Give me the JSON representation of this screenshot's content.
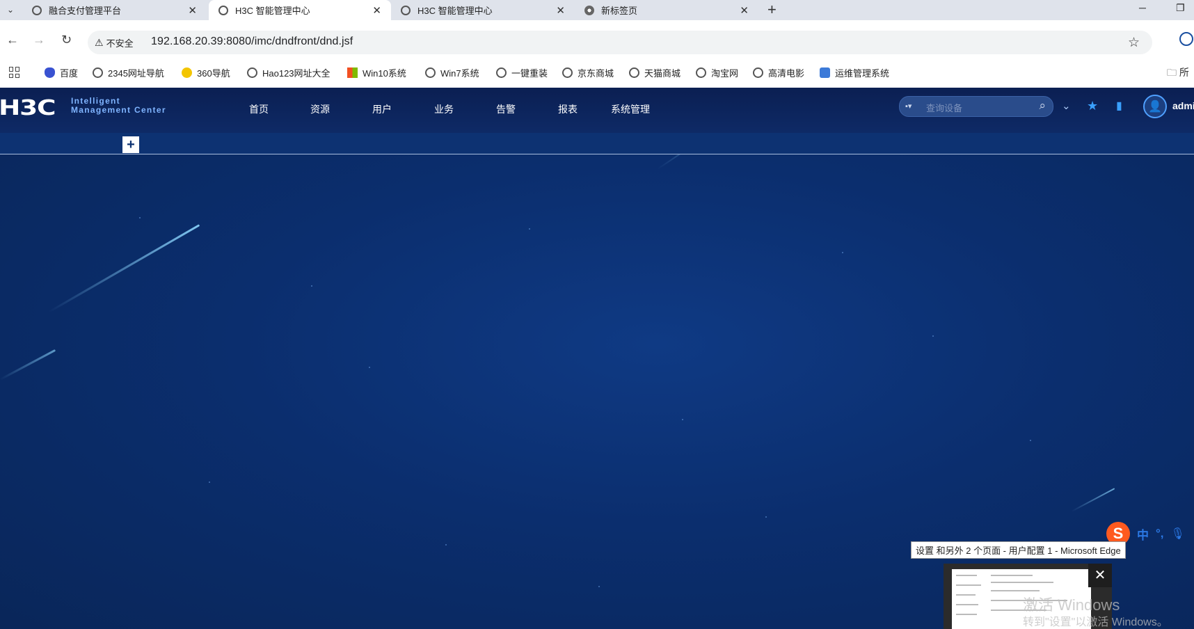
{
  "browser": {
    "tabs": [
      {
        "title": "融合支付管理平台",
        "active": false
      },
      {
        "title": "H3C 智能管理中心",
        "active": true
      },
      {
        "title": "H3C 智能管理中心",
        "active": false
      },
      {
        "title": "新标签页",
        "active": false
      }
    ],
    "security_label": "不安全",
    "url": "192.168.20.39:8080/imc/dndfront/dnd.jsf",
    "bookmarks": [
      "百度",
      "2345网址导航",
      "360导航",
      "Hao123网址大全",
      "Win10系统",
      "Win7系统",
      "一键重装",
      "京东商城",
      "天猫商城",
      "淘宝网",
      "高清电影",
      "运维管理系统"
    ],
    "bookmarks_overflow": "所"
  },
  "app": {
    "logo": "H3C",
    "logo_line1": "Intelligent",
    "logo_line2": "Management Center",
    "menu": [
      "首页",
      "资源",
      "用户",
      "业务",
      "告警",
      "报表",
      "系统管理"
    ],
    "search_placeholder": "查询设备",
    "username": "admi",
    "accent": "#4fa0ff",
    "header_bg": "#0e2a66"
  },
  "overlay": {
    "ime_zh": "中",
    "ime_punct": "°,",
    "taskbar_tooltip": "设置 和另外 2 个页面 - 用户配置 1 - Microsoft Edge",
    "watermark_line1": "激活 Windows",
    "watermark_line2": "转到\"设置\"以激活 Windows。"
  }
}
